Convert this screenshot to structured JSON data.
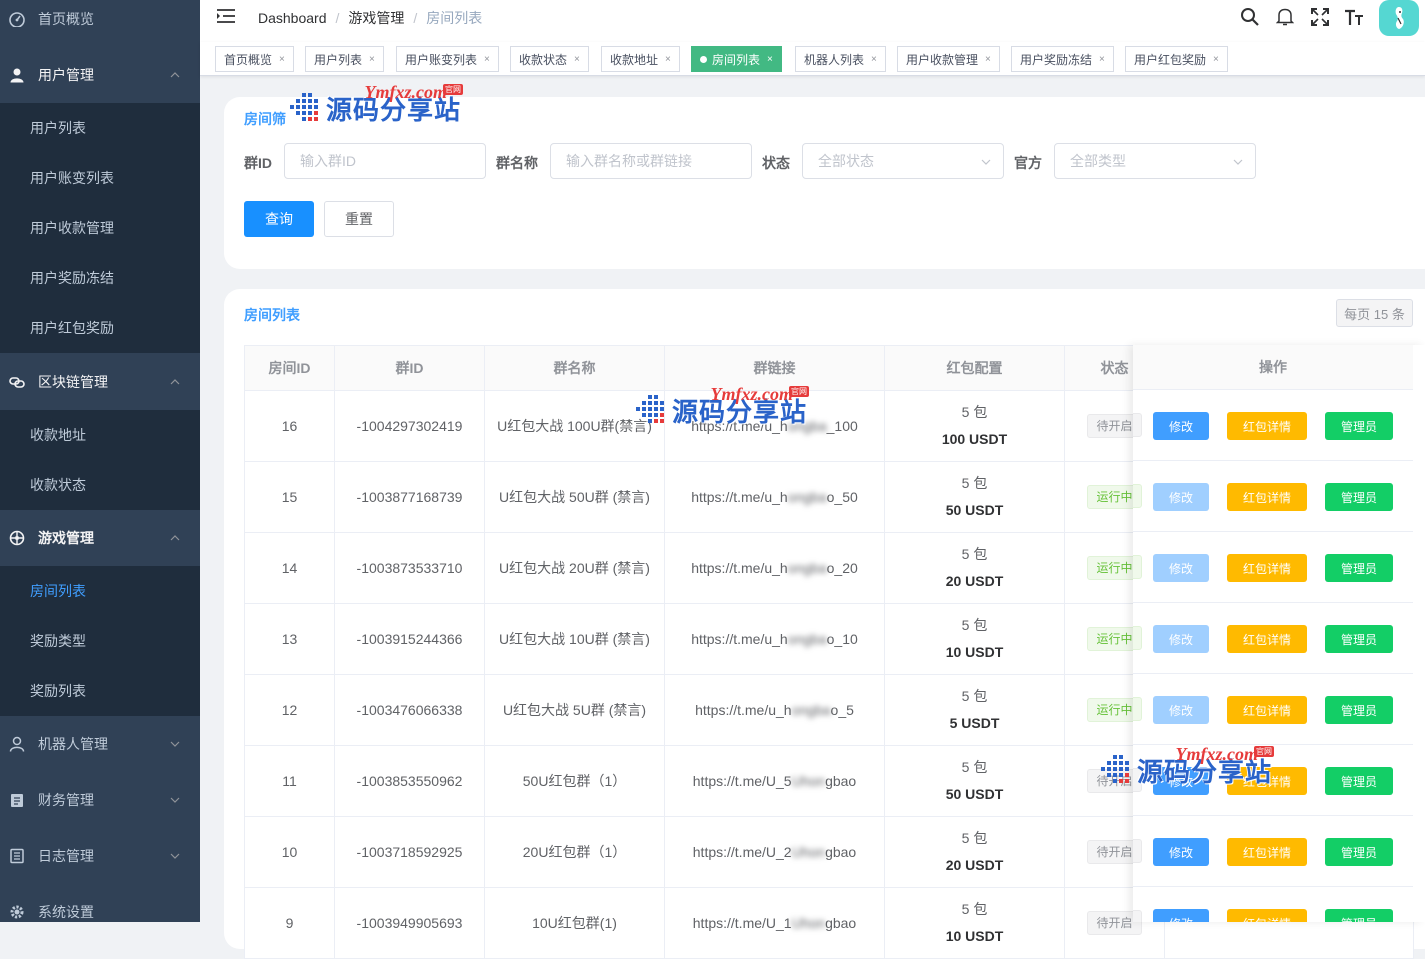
{
  "sidebar": {
    "items": [
      {
        "label": "首页概览",
        "icon": "dashboard-icon"
      },
      {
        "label": "用户管理",
        "icon": "user-icon",
        "open": true,
        "children": [
          "用户列表",
          "用户账变列表",
          "用户收款管理",
          "用户奖励冻结",
          "用户红包奖励"
        ]
      },
      {
        "label": "区块链管理",
        "icon": "link-icon",
        "open": true,
        "children": [
          "收款地址",
          "收款状态"
        ]
      },
      {
        "label": "游戏管理",
        "icon": "game-icon",
        "open": true,
        "children": [
          "房间列表",
          "奖励类型",
          "奖励列表"
        ],
        "active_child": "房间列表"
      },
      {
        "label": "机器人管理",
        "icon": "robot-icon"
      },
      {
        "label": "财务管理",
        "icon": "finance-icon"
      },
      {
        "label": "日志管理",
        "icon": "log-icon"
      },
      {
        "label": "系统设置",
        "icon": "settings-icon"
      }
    ]
  },
  "breadcrumb": [
    "Dashboard",
    "游戏管理",
    "房间列表"
  ],
  "tags": [
    "首页概览",
    "用户列表",
    "用户账变列表",
    "收款状态",
    "收款地址",
    "房间列表",
    "机器人列表",
    "用户收款管理",
    "用户奖励冻结",
    "用户红包奖励"
  ],
  "active_tag": "房间列表",
  "filter": {
    "title": "房间筛",
    "group_id_label": "群ID",
    "group_id_placeholder": "输入群ID",
    "group_name_label": "群名称",
    "group_name_placeholder": "输入群名称或群链接",
    "status_label": "状态",
    "status_value": "全部状态",
    "official_label": "官方",
    "official_value": "全部类型",
    "query_button": "查询",
    "reset_button": "重置"
  },
  "list": {
    "title": "房间列表",
    "per_page": "每页 15 条",
    "columns": [
      "房间ID",
      "群ID",
      "群名称",
      "群链接",
      "红包配置",
      "状态",
      "操作"
    ],
    "rows": [
      {
        "id": "16",
        "group_id": "-1004297302419",
        "name": "U红包大战 100U群(禁言)",
        "link_a": "https://t.me/u_h",
        "link_b": "_100",
        "packs": "5 包",
        "amount": "100 USDT",
        "status": "待开启",
        "running": false
      },
      {
        "id": "15",
        "group_id": "-1003877168739",
        "name": "U红包大战 50U群 (禁言)",
        "link_a": "https://t.me/u_h",
        "link_b": "o_50",
        "packs": "5 包",
        "amount": "50 USDT",
        "status": "运行中",
        "running": true
      },
      {
        "id": "14",
        "group_id": "-1003873533710",
        "name": "U红包大战 20U群 (禁言)",
        "link_a": "https://t.me/u_h",
        "link_b": "o_20",
        "packs": "5 包",
        "amount": "20 USDT",
        "status": "运行中",
        "running": true
      },
      {
        "id": "13",
        "group_id": "-1003915244366",
        "name": "U红包大战 10U群 (禁言)",
        "link_a": "https://t.me/u_h",
        "link_b": "o_10",
        "packs": "5 包",
        "amount": "10 USDT",
        "status": "运行中",
        "running": true
      },
      {
        "id": "12",
        "group_id": "-1003476066338",
        "name": "U红包大战 5U群 (禁言)",
        "link_a": "https://t.me/u_h",
        "link_b": "o_5",
        "packs": "5 包",
        "amount": "5 USDT",
        "status": "运行中",
        "running": true
      },
      {
        "id": "11",
        "group_id": "-1003853550962",
        "name": "50U红包群（1）",
        "link_a": "https://t.me/U_5",
        "link_b": "gbao",
        "packs": "5 包",
        "amount": "50 USDT",
        "status": "待开启",
        "running": false
      },
      {
        "id": "10",
        "group_id": "-1003718592925",
        "name": "20U红包群（1）",
        "link_a": "https://t.me/U_2",
        "link_b": "gbao",
        "packs": "5 包",
        "amount": "20 USDT",
        "status": "待开启",
        "running": false
      },
      {
        "id": "9",
        "group_id": "-1003949905693",
        "name": "10U红包群(1)",
        "link_a": "https://t.me/U_1",
        "link_b": "gbao",
        "packs": "5 包",
        "amount": "10 USDT",
        "status": "待开启",
        "running": false
      }
    ],
    "actions": {
      "edit": "修改",
      "redpack": "红包详情",
      "admin": "管理员"
    }
  },
  "watermark": {
    "en": "Ymfxz.com",
    "badge": "官网",
    "cn": "源码分享站"
  },
  "colors": {
    "sidebar_bg": "#304156",
    "submenu_bg": "#1f2d3d",
    "primary": "#409eff",
    "success_tag": "#42b983",
    "warning": "#ffba00",
    "success": "#13ce66",
    "avatar_bg": "#55d7d2"
  }
}
